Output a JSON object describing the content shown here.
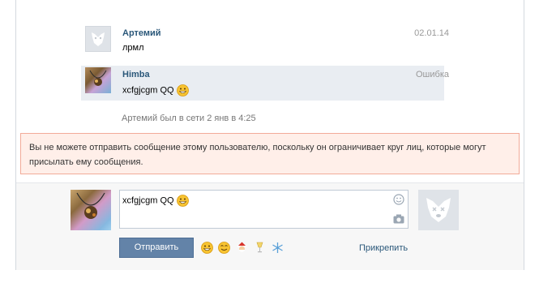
{
  "messages": [
    {
      "author": "Артемий",
      "text": "лрмл",
      "meta": "02.01.14",
      "avatar": "vk-dog-icon",
      "highlighted": false
    },
    {
      "author": "Himba",
      "text": "xcfgjcgm QQ",
      "meta": "Ошибка",
      "avatar": "user-photo",
      "highlighted": true
    }
  ],
  "status_line": "Артемий был в сети 2 янв в 4:25",
  "error": {
    "text": "Вы не можете отправить сообщение этому пользователю, поскольку он ограничивает круг лиц, которые могут присылать ему сообщения."
  },
  "composer": {
    "value": "xcfgjcgm QQ",
    "send_label": "Отправить",
    "attach_label": "Прикрепить"
  },
  "emoji_bar": [
    "grin-emoji-icon",
    "smile-emoji-icon",
    "santa-emoji-icon",
    "champagne-emoji-icon",
    "snowflake-emoji-icon"
  ],
  "colors": {
    "link": "#2b587a",
    "button": "#6383a8",
    "error_bg": "#ffefe9",
    "error_border": "#f2ab99",
    "highlight_bg": "#e9edf2"
  }
}
